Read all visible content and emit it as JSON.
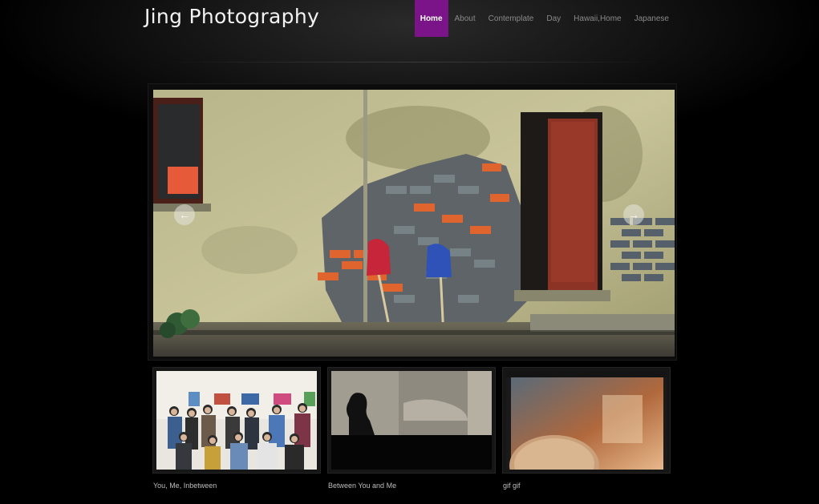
{
  "site": {
    "title": "Jing Photography"
  },
  "nav": {
    "items": [
      {
        "label": "Home"
      },
      {
        "label": "About"
      },
      {
        "label": "Contemplate"
      },
      {
        "label": "Day"
      },
      {
        "label": "Hawaii,Home"
      },
      {
        "label": "Japanese"
      }
    ]
  },
  "slider": {
    "prev_icon": "arrow-left-icon",
    "next_icon": "arrow-right-icon",
    "prev_glyph": "←",
    "next_glyph": "→"
  },
  "gallery": {
    "items": [
      {
        "caption": "You, Me, Inbetween"
      },
      {
        "caption": "Between You and Me"
      },
      {
        "caption": "gif gif"
      }
    ]
  },
  "colors": {
    "accent": "#7b1489",
    "background": "#000000",
    "title": "#f2f2f2",
    "nav_text": "#8a8a8a"
  }
}
